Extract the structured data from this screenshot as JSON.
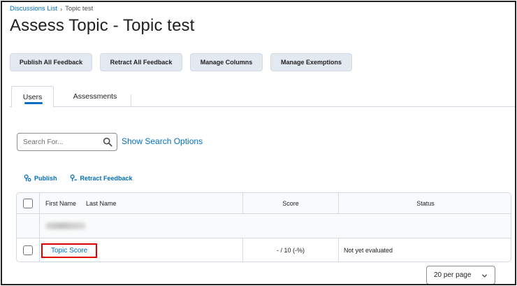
{
  "breadcrumb": {
    "parent": "Discussions List",
    "separator": "›",
    "current": "Topic test"
  },
  "page": {
    "title": "Assess Topic - Topic test"
  },
  "toolbar": {
    "publish_all": "Publish All Feedback",
    "retract_all": "Retract All Feedback",
    "manage_columns": "Manage Columns",
    "manage_exemptions": "Manage Exemptions"
  },
  "tabs": [
    {
      "label": "Users",
      "active": true
    },
    {
      "label": "Assessments",
      "active": false
    }
  ],
  "search": {
    "placeholder": "Search For...",
    "options_link": "Show Search Options"
  },
  "actions": {
    "publish": "Publish",
    "retract": "Retract Feedback"
  },
  "table": {
    "headers": {
      "first_name": "First Name",
      "last_name": "Last Name",
      "score": "Score",
      "status": "Status"
    },
    "rows": [
      {
        "name": "Topic Score",
        "score": "- / 10 (-%)",
        "status": "Not yet evaluated"
      }
    ]
  },
  "pagination": {
    "per_page": "20 per page"
  },
  "colors": {
    "link": "#006fbf",
    "button_bg": "#e3e9f1",
    "highlight": "#e00000"
  },
  "icons": {
    "search": "search-icon",
    "publish": "publish-icon",
    "retract": "retract-icon",
    "chevron": "chevron-down-icon"
  }
}
